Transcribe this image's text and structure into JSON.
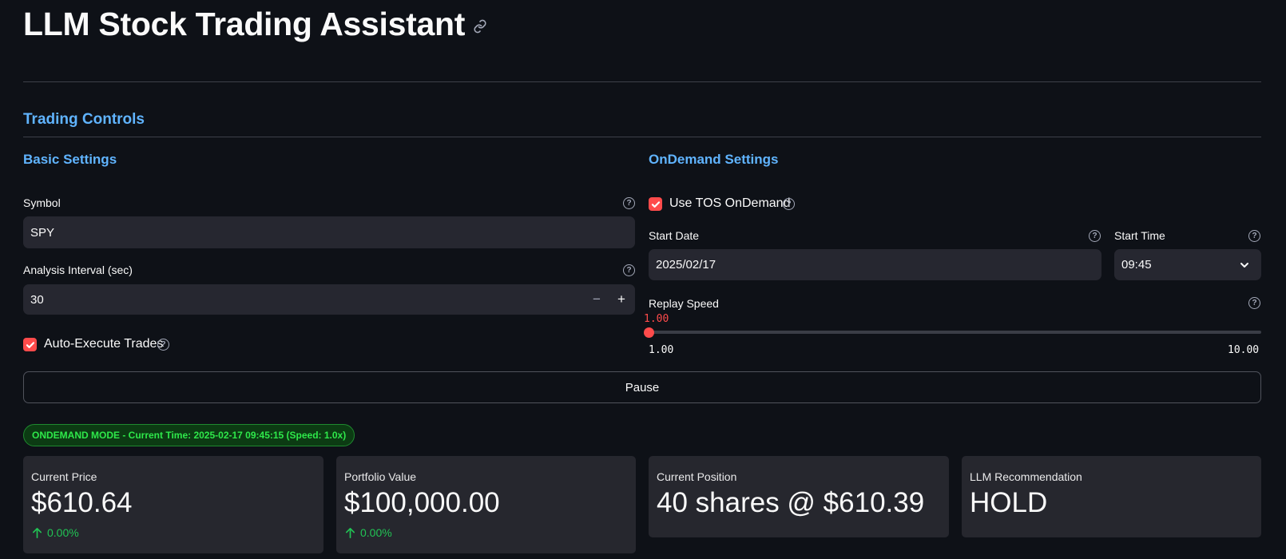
{
  "header": {
    "title": "LLM Stock Trading Assistant"
  },
  "trading_controls": {
    "title": "Trading Controls"
  },
  "basic_settings": {
    "title": "Basic Settings",
    "symbol_label": "Symbol",
    "symbol_value": "SPY",
    "interval_label": "Analysis Interval (sec)",
    "interval_value": "30",
    "minus": "−",
    "plus": "+",
    "auto_execute_label": "Auto-Execute Trades",
    "auto_execute_checked": true
  },
  "ondemand_settings": {
    "title": "OnDemand Settings",
    "use_tos_label": "Use TOS OnDemand",
    "use_tos_checked": true,
    "start_date_label": "Start Date",
    "start_date_value": "2025/02/17",
    "start_time_label": "Start Time",
    "start_time_value": "09:45",
    "replay_label": "Replay Speed",
    "replay_value": "1.00",
    "replay_min": "1.00",
    "replay_max": "10.00"
  },
  "pause_button": "Pause",
  "status": "ONDEMAND MODE - Current Time: 2025-02-17 09:45:15 (Speed: 1.0x)",
  "metrics": {
    "price": {
      "label": "Current Price",
      "value": "$610.64",
      "delta": "0.00%"
    },
    "portfolio": {
      "label": "Portfolio Value",
      "value": "$100,000.00",
      "delta": "0.00%"
    },
    "position": {
      "label": "Current Position",
      "value": "40 shares @ $610.39"
    },
    "recommendation": {
      "label": "LLM Recommendation",
      "value": "HOLD"
    }
  },
  "colors": {
    "accent": "#ff4b4b",
    "section_title": "#60b4ff",
    "positive": "#21c354",
    "status_text": "#2ee84a",
    "background": "#0e1117"
  }
}
